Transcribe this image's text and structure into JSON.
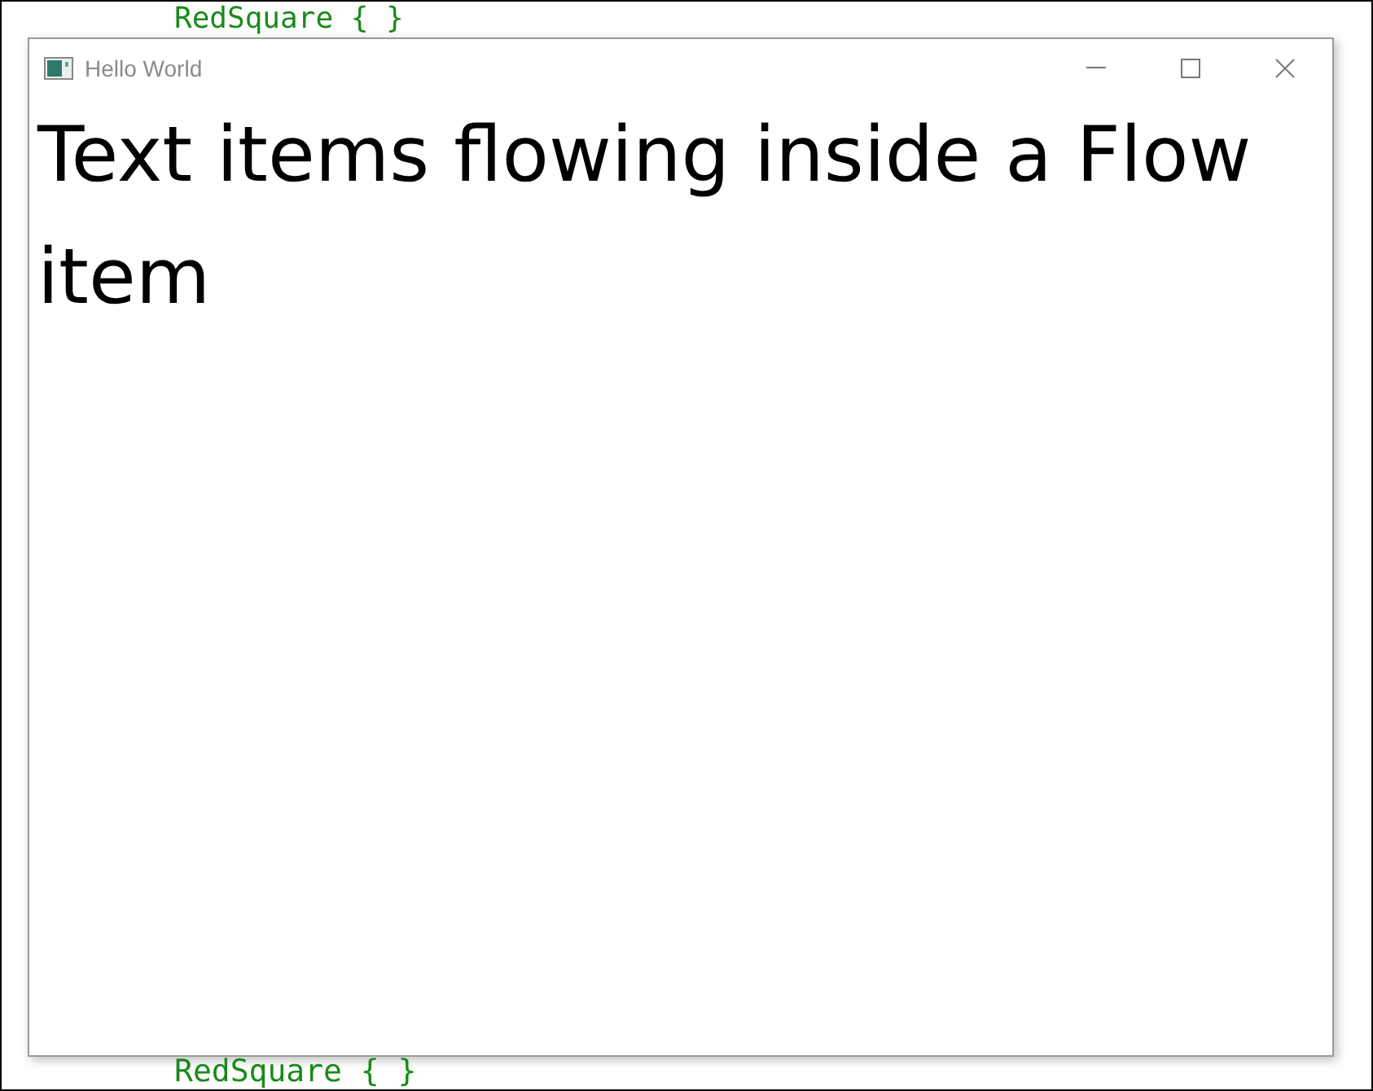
{
  "background_code": {
    "top_line": "RedSquare { }",
    "bottom_line": "RedSquare { }"
  },
  "window": {
    "title": "Hello World",
    "heading": "Text items flowing inside a Flow item"
  }
}
